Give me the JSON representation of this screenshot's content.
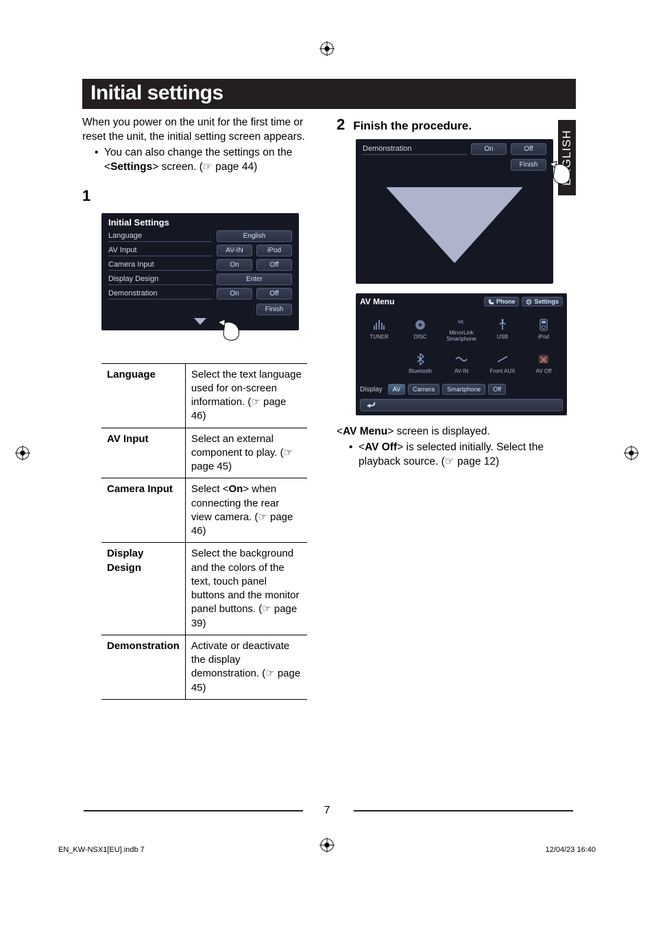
{
  "page": {
    "title": "Initial settings",
    "side_tab": "ENGLISH",
    "page_number": "7",
    "footer_left": "EN_KW-NSX1[EU].indb   7",
    "footer_right": "12/04/23   16:40"
  },
  "intro": {
    "line": "When you power on the unit for the first time or reset the unit, the initial setting screen appears.",
    "bullet_pre": "You can also change the settings on the <",
    "bullet_bold": "Settings",
    "bullet_post": "> screen. (☞ page 44)"
  },
  "step1": {
    "number": "1"
  },
  "screenshot1": {
    "title": "Initial Settings",
    "rows": [
      {
        "label": "Language",
        "buttons": [
          "English"
        ]
      },
      {
        "label": "AV Input",
        "buttons": [
          "AV-IN",
          "iPod"
        ]
      },
      {
        "label": "Camera Input",
        "buttons": [
          "On",
          "Off"
        ]
      },
      {
        "label": "Display Design",
        "buttons": [
          "Enter"
        ]
      },
      {
        "label": "Demonstration",
        "buttons": [
          "On",
          "Off"
        ]
      }
    ],
    "finish": "Finish"
  },
  "settings_table": [
    {
      "name": "Language",
      "desc_parts": [
        "Select the text language used for on-screen information. (☞ page 46)"
      ]
    },
    {
      "name": "AV Input",
      "desc_parts": [
        "Select an external component to play. (☞ page 45)"
      ]
    },
    {
      "name": "Camera Input",
      "desc_pre": "Select <",
      "desc_bold": "On",
      "desc_post": "> when connecting the rear view camera. (☞ page 46)"
    },
    {
      "name": "Display Design",
      "desc_parts": [
        "Select the background and the colors of the text, touch panel buttons and the monitor panel buttons. (☞ page 39)"
      ]
    },
    {
      "name": "Demonstration",
      "desc_parts": [
        "Activate or deactivate the display demonstration. (☞ page 45)"
      ]
    }
  ],
  "step2": {
    "number": "2",
    "heading": "Finish the procedure."
  },
  "screenshot2a": {
    "label": "Demonstration",
    "on": "On",
    "off": "Off",
    "finish": "Finish"
  },
  "screenshot2b": {
    "title": "AV Menu",
    "top_right": [
      {
        "icon": "phone-icon",
        "label": "Phone"
      },
      {
        "icon": "gear-icon",
        "label": "Settings"
      }
    ],
    "sources": [
      {
        "icon": "tuner-icon",
        "label": "TUNER"
      },
      {
        "icon": "disc-icon",
        "label": "DISC"
      },
      {
        "icon": "mirrorlink-icon",
        "label": "MirrorLink Smartphone"
      },
      {
        "icon": "usb-icon",
        "label": "USB"
      },
      {
        "icon": "ipod-icon",
        "label": "iPod"
      },
      {
        "icon": "bluetooth-icon",
        "label": "Bluetooth"
      },
      {
        "icon": "avin-icon",
        "label": "AV-IN"
      },
      {
        "icon": "frontaux-icon",
        "label": "Front AUX"
      },
      {
        "icon": "avoff-icon",
        "label": "AV Off"
      }
    ],
    "bottom": {
      "display": "Display",
      "tabs": [
        "AV",
        "Camera",
        "Smartphone",
        "Off"
      ],
      "back": "↩"
    }
  },
  "right_text": {
    "line_pre": "<",
    "line_bold": "AV Menu",
    "line_post": "> screen is displayed.",
    "bullet_pre": "<",
    "bullet_bold": "AV Off",
    "bullet_post": "> is selected initially. Select the playback source. (☞ page 12)"
  }
}
